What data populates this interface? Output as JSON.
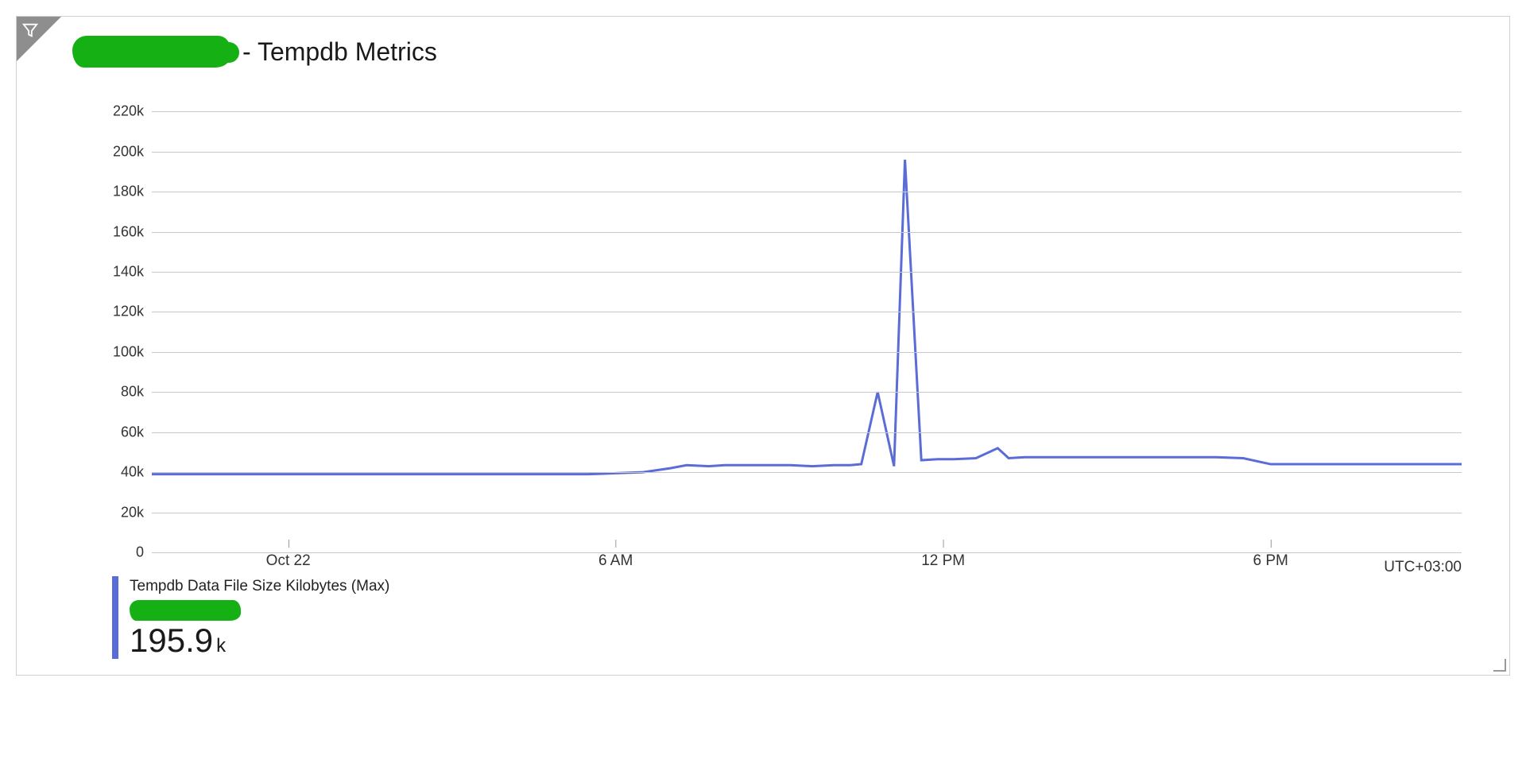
{
  "header": {
    "title_suffix": "- Tempdb Metrics"
  },
  "legend": {
    "series_label": "Tempdb Data File Size Kilobytes (Max)",
    "value": "195.9",
    "unit": "k"
  },
  "timezone": "UTC+03:00",
  "colors": {
    "series": "#5a6cd6",
    "redaction": "#14b014"
  },
  "chart_data": {
    "type": "line",
    "title": "Tempdb Metrics",
    "ylabel": "",
    "xlabel": "",
    "ylim": [
      0,
      230000
    ],
    "y_ticks": [
      0,
      20000,
      40000,
      60000,
      80000,
      100000,
      120000,
      140000,
      160000,
      180000,
      200000,
      220000
    ],
    "y_tick_labels": [
      "0",
      "20k",
      "40k",
      "60k",
      "80k",
      "100k",
      "120k",
      "140k",
      "160k",
      "180k",
      "200k",
      "220k"
    ],
    "x_tick_positions_hours": [
      0,
      6,
      12,
      18
    ],
    "x_tick_labels": [
      "Oct 22",
      "6 AM",
      "12 PM",
      "6 PM"
    ],
    "x_range_hours": [
      -2.5,
      21.5
    ],
    "series": [
      {
        "name": "Tempdb Data File Size Kilobytes (Max)",
        "color": "#5a6cd6",
        "x_hours": [
          -2.5,
          -2,
          -1,
          0,
          1,
          2,
          3,
          4,
          5,
          5.5,
          6,
          6.5,
          7,
          7.3,
          7.7,
          8,
          8.4,
          8.8,
          9.2,
          9.6,
          10,
          10.3,
          10.5,
          10.8,
          11.1,
          11.3,
          11.6,
          11.9,
          12.2,
          12.6,
          13,
          13.2,
          13.5,
          14,
          15,
          16,
          17,
          17.5,
          18,
          19,
          20,
          21,
          21.5
        ],
        "values": [
          39000,
          39000,
          39000,
          39000,
          39000,
          39000,
          39000,
          39000,
          39000,
          39000,
          39500,
          40000,
          42000,
          43500,
          43000,
          43500,
          43500,
          43500,
          43500,
          43000,
          43500,
          43500,
          44000,
          80000,
          43000,
          195900,
          46000,
          46500,
          46500,
          47000,
          52000,
          47000,
          47500,
          47500,
          47500,
          47500,
          47500,
          47000,
          44000,
          44000,
          44000,
          44000,
          44000
        ]
      }
    ]
  }
}
